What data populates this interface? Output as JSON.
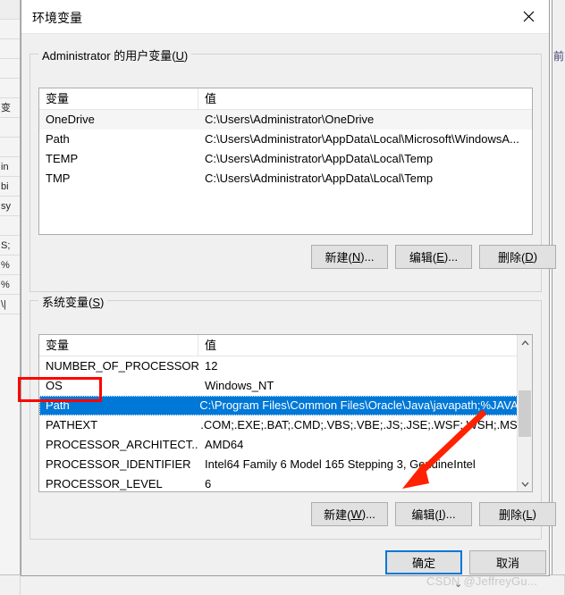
{
  "window": {
    "title": "环境变量",
    "close_icon": "close-x-icon"
  },
  "user_group": {
    "legend_prefix": "Administrator 的用户变量(",
    "legend_mnemonic": "U",
    "legend_suffix": ")",
    "columns": [
      "变量",
      "值"
    ],
    "rows": [
      {
        "name": "OneDrive",
        "value": "C:\\Users\\Administrator\\OneDrive"
      },
      {
        "name": "Path",
        "value": "C:\\Users\\Administrator\\AppData\\Local\\Microsoft\\WindowsA..."
      },
      {
        "name": "TEMP",
        "value": "C:\\Users\\Administrator\\AppData\\Local\\Temp"
      },
      {
        "name": "TMP",
        "value": "C:\\Users\\Administrator\\AppData\\Local\\Temp"
      }
    ],
    "buttons": [
      {
        "prefix": "新建(",
        "mnemonic": "N",
        "suffix": ")..."
      },
      {
        "prefix": "编辑(",
        "mnemonic": "E",
        "suffix": ")..."
      },
      {
        "prefix": "删除(",
        "mnemonic": "D",
        "suffix": ")"
      }
    ]
  },
  "system_group": {
    "legend_prefix": "系统变量(",
    "legend_mnemonic": "S",
    "legend_suffix": ")",
    "columns": [
      "变量",
      "值"
    ],
    "rows": [
      {
        "name": "NUMBER_OF_PROCESSORS",
        "value": "12",
        "selected": false
      },
      {
        "name": "OS",
        "value": "Windows_NT",
        "selected": false
      },
      {
        "name": "Path",
        "value": "C:\\Program Files\\Common Files\\Oracle\\Java\\javapath;%JAVA...",
        "selected": true
      },
      {
        "name": "PATHEXT",
        "value": ".COM;.EXE;.BAT;.CMD;.VBS;.VBE;.JS;.JSE;.WSF;.WSH;.MSC",
        "selected": false
      },
      {
        "name": "PROCESSOR_ARCHITECT...",
        "value": "AMD64",
        "selected": false
      },
      {
        "name": "PROCESSOR_IDENTIFIER",
        "value": "Intel64 Family 6 Model 165 Stepping 3, GenuineIntel",
        "selected": false
      },
      {
        "name": "PROCESSOR_LEVEL",
        "value": "6",
        "selected": false
      }
    ],
    "buttons": [
      {
        "prefix": "新建(",
        "mnemonic": "W",
        "suffix": ")..."
      },
      {
        "prefix": "编辑(",
        "mnemonic": "I",
        "suffix": ")..."
      },
      {
        "prefix": "删除(",
        "mnemonic": "L",
        "suffix": ")"
      }
    ],
    "scrollbar": {
      "up_icon": "chevron-up-icon",
      "down_icon": "chevron-down-icon"
    }
  },
  "footer": {
    "ok_label": "确定",
    "cancel_label": "取消"
  },
  "annotations": {
    "highlight_rect_target": "system Path row",
    "arrow_target": "system edit button",
    "accent_color": "#ff0000",
    "selection_color": "#0078d7"
  },
  "watermark": {
    "text": "CSDN @JeffreyGu..."
  },
  "background": {
    "left_rows": [
      "",
      "",
      "",
      "",
      "",
      "变",
      "",
      "",
      "in",
      "bi",
      "sy",
      "",
      "S;",
      "%",
      "%",
      "\\|"
    ],
    "right_glyph": "前",
    "bottom_chevron": "⌄"
  }
}
